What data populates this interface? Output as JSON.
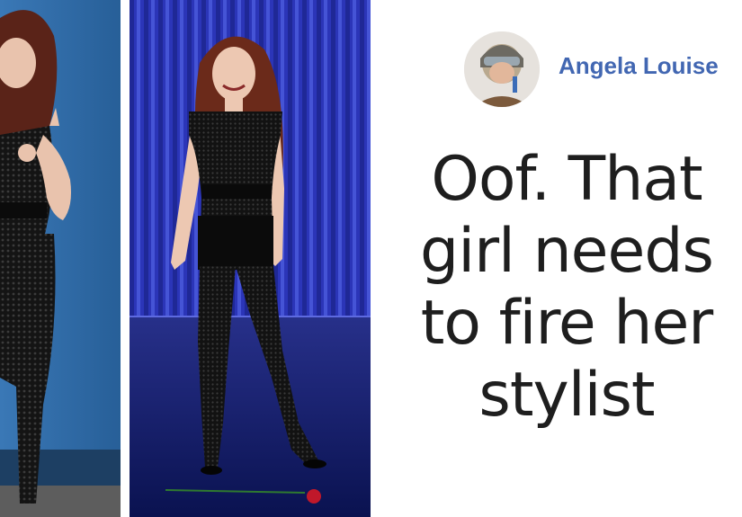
{
  "post": {
    "author_name": "Angela Louise",
    "comment_lines": [
      "Oof. That",
      "girl needs",
      "to fire her",
      "stylist"
    ]
  },
  "photos": {
    "left": {
      "background": "#2e6ca6"
    },
    "right": {
      "curtain": "#2b35b8",
      "stage_floor": "#0e1a6e"
    }
  },
  "colors": {
    "author": "#4267b2",
    "text": "#1e1e1e"
  }
}
